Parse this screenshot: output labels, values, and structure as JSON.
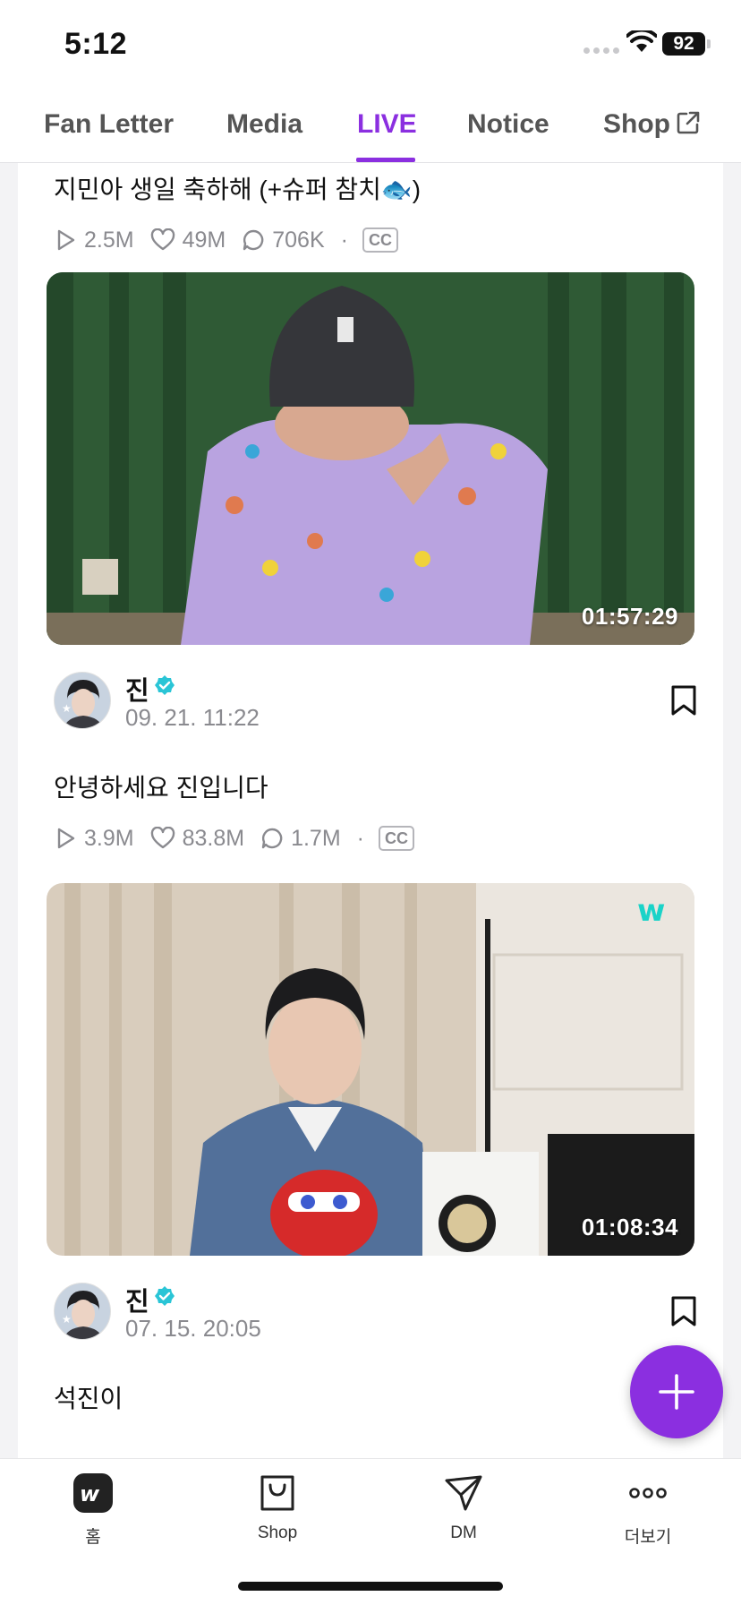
{
  "status_bar": {
    "time": "5:12",
    "battery": "92"
  },
  "tabs": [
    {
      "label": "Fan Letter",
      "active": false
    },
    {
      "label": "Media",
      "active": false
    },
    {
      "label": "LIVE",
      "active": true
    },
    {
      "label": "Notice",
      "active": false
    },
    {
      "label": "Shop",
      "active": false,
      "external": true
    }
  ],
  "posts": [
    {
      "title": "지민아 생일 축하해 (+슈퍼 참치🐟)",
      "stats": {
        "plays": "2.5M",
        "likes": "49M",
        "comments": "706K",
        "cc": "CC"
      }
    },
    {
      "duration": "01:57:29",
      "author": "진",
      "date": "09. 21. 11:22",
      "title": "안녕하세요 진입니다",
      "stats": {
        "plays": "3.9M",
        "likes": "83.8M",
        "comments": "1.7M",
        "cc": "CC"
      }
    },
    {
      "duration": "01:08:34",
      "author": "진",
      "date": "07. 15. 20:05",
      "title": "석진이"
    }
  ],
  "bottom_nav": [
    {
      "label": "홈",
      "icon": "weverse-home-icon"
    },
    {
      "label": "Shop",
      "icon": "shopping-bag-icon"
    },
    {
      "label": "DM",
      "icon": "paper-plane-icon"
    },
    {
      "label": "더보기",
      "icon": "more-dots-icon"
    }
  ],
  "colors": {
    "accent": "#8b2fe0",
    "verified": "#2ac5d6",
    "text_muted": "#8a8a8f"
  }
}
